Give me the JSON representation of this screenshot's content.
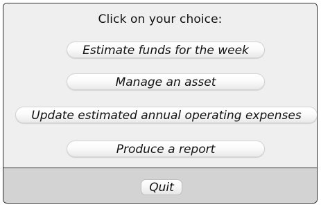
{
  "dialog": {
    "prompt": "Click on your choice:",
    "choices": [
      {
        "label": "Estimate funds for the week"
      },
      {
        "label": "Manage an asset"
      },
      {
        "label": "Update estimated annual operating expenses"
      },
      {
        "label": "Produce a report"
      }
    ],
    "quit_label": "Quit"
  },
  "colors": {
    "panel_background": "#efefef",
    "footer_background": "#d3d3d3",
    "border": "#2a2a2a",
    "text": "#111111"
  }
}
